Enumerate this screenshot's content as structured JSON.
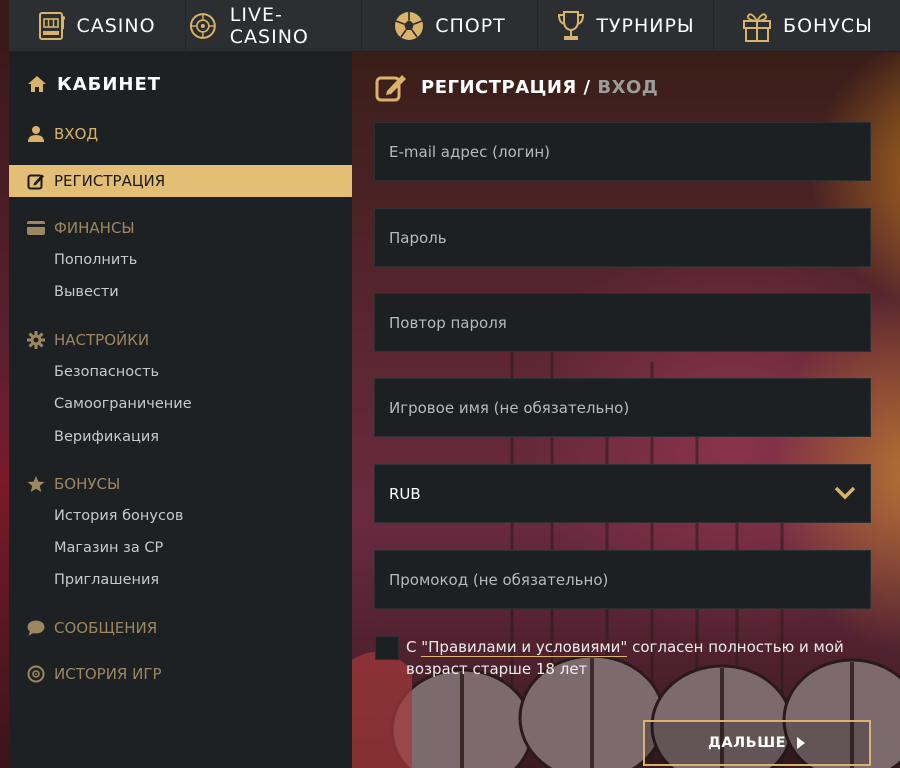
{
  "topnav": {
    "items": [
      {
        "label": "CASINO",
        "icon": "slot-machine-icon"
      },
      {
        "label": "LIVE-CASINO",
        "icon": "roulette-icon"
      },
      {
        "label": "СПОРТ",
        "icon": "soccer-ball-icon"
      },
      {
        "label": "ТУРНИРЫ",
        "icon": "trophy-icon"
      },
      {
        "label": "БОНУСЫ",
        "icon": "gift-icon"
      }
    ]
  },
  "sidebar": {
    "title": "КАБИНЕТ",
    "login": "ВХОД",
    "registration": "РЕГИСТРАЦИЯ",
    "finance": {
      "label": "ФИНАНСЫ",
      "items": [
        "Пополнить",
        "Вывести"
      ]
    },
    "settings": {
      "label": "НАСТРОЙКИ",
      "items": [
        "Безопасность",
        "Самоограничение",
        "Верификация"
      ]
    },
    "bonuses": {
      "label": "БОНУСЫ",
      "items": [
        "История бонусов",
        "Магазин за CP",
        "Приглашения"
      ]
    },
    "messages": "СООБЩЕНИЯ",
    "game_history": "ИСТОРИЯ ИГР"
  },
  "form": {
    "title": "РЕГИСТРАЦИЯ",
    "separator": " / ",
    "title_alt": "ВХОД",
    "email_placeholder": "E-mail адрес (логин)",
    "password_placeholder": "Пароль",
    "password_repeat_placeholder": "Повтор пароля",
    "nickname_placeholder": "Игровое имя (не обязательно)",
    "currency": "RUB",
    "promo_placeholder": "Промокод (не обязательно)",
    "agree_prefix": "С ",
    "agree_link": "\"Правилами и условиями\"",
    "agree_suffix": " согласен полностью и мой возраст старше 18 лет",
    "agree_checked": false,
    "next_button": "ДАЛЬШЕ"
  },
  "colors": {
    "accent": "#d9b36a",
    "active_bg": "#e3be74",
    "sidebar_bg": "#1d2123",
    "nav_bg": "#2b2f31",
    "field_bg": "#1c2022"
  }
}
